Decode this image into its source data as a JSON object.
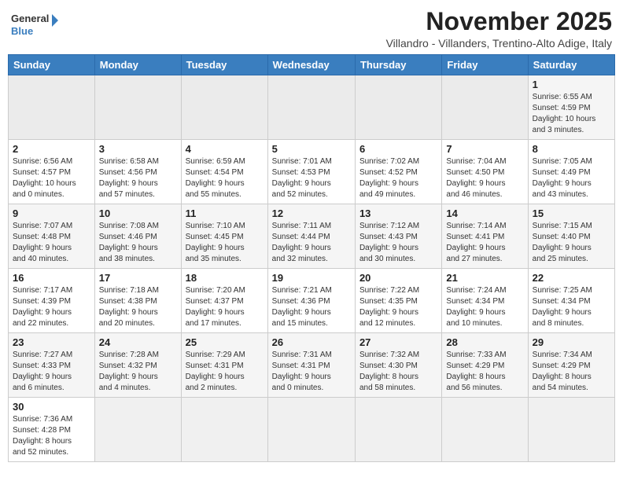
{
  "logo": {
    "text_general": "General",
    "text_blue": "Blue"
  },
  "title": "November 2025",
  "subtitle": "Villandro - Villanders, Trentino-Alto Adige, Italy",
  "weekdays": [
    "Sunday",
    "Monday",
    "Tuesday",
    "Wednesday",
    "Thursday",
    "Friday",
    "Saturday"
  ],
  "weeks": [
    [
      {
        "day": "",
        "info": ""
      },
      {
        "day": "",
        "info": ""
      },
      {
        "day": "",
        "info": ""
      },
      {
        "day": "",
        "info": ""
      },
      {
        "day": "",
        "info": ""
      },
      {
        "day": "",
        "info": ""
      },
      {
        "day": "1",
        "info": "Sunrise: 6:55 AM\nSunset: 4:59 PM\nDaylight: 10 hours\nand 3 minutes."
      }
    ],
    [
      {
        "day": "2",
        "info": "Sunrise: 6:56 AM\nSunset: 4:57 PM\nDaylight: 10 hours\nand 0 minutes."
      },
      {
        "day": "3",
        "info": "Sunrise: 6:58 AM\nSunset: 4:56 PM\nDaylight: 9 hours\nand 57 minutes."
      },
      {
        "day": "4",
        "info": "Sunrise: 6:59 AM\nSunset: 4:54 PM\nDaylight: 9 hours\nand 55 minutes."
      },
      {
        "day": "5",
        "info": "Sunrise: 7:01 AM\nSunset: 4:53 PM\nDaylight: 9 hours\nand 52 minutes."
      },
      {
        "day": "6",
        "info": "Sunrise: 7:02 AM\nSunset: 4:52 PM\nDaylight: 9 hours\nand 49 minutes."
      },
      {
        "day": "7",
        "info": "Sunrise: 7:04 AM\nSunset: 4:50 PM\nDaylight: 9 hours\nand 46 minutes."
      },
      {
        "day": "8",
        "info": "Sunrise: 7:05 AM\nSunset: 4:49 PM\nDaylight: 9 hours\nand 43 minutes."
      }
    ],
    [
      {
        "day": "9",
        "info": "Sunrise: 7:07 AM\nSunset: 4:48 PM\nDaylight: 9 hours\nand 40 minutes."
      },
      {
        "day": "10",
        "info": "Sunrise: 7:08 AM\nSunset: 4:46 PM\nDaylight: 9 hours\nand 38 minutes."
      },
      {
        "day": "11",
        "info": "Sunrise: 7:10 AM\nSunset: 4:45 PM\nDaylight: 9 hours\nand 35 minutes."
      },
      {
        "day": "12",
        "info": "Sunrise: 7:11 AM\nSunset: 4:44 PM\nDaylight: 9 hours\nand 32 minutes."
      },
      {
        "day": "13",
        "info": "Sunrise: 7:12 AM\nSunset: 4:43 PM\nDaylight: 9 hours\nand 30 minutes."
      },
      {
        "day": "14",
        "info": "Sunrise: 7:14 AM\nSunset: 4:41 PM\nDaylight: 9 hours\nand 27 minutes."
      },
      {
        "day": "15",
        "info": "Sunrise: 7:15 AM\nSunset: 4:40 PM\nDaylight: 9 hours\nand 25 minutes."
      }
    ],
    [
      {
        "day": "16",
        "info": "Sunrise: 7:17 AM\nSunset: 4:39 PM\nDaylight: 9 hours\nand 22 minutes."
      },
      {
        "day": "17",
        "info": "Sunrise: 7:18 AM\nSunset: 4:38 PM\nDaylight: 9 hours\nand 20 minutes."
      },
      {
        "day": "18",
        "info": "Sunrise: 7:20 AM\nSunset: 4:37 PM\nDaylight: 9 hours\nand 17 minutes."
      },
      {
        "day": "19",
        "info": "Sunrise: 7:21 AM\nSunset: 4:36 PM\nDaylight: 9 hours\nand 15 minutes."
      },
      {
        "day": "20",
        "info": "Sunrise: 7:22 AM\nSunset: 4:35 PM\nDaylight: 9 hours\nand 12 minutes."
      },
      {
        "day": "21",
        "info": "Sunrise: 7:24 AM\nSunset: 4:34 PM\nDaylight: 9 hours\nand 10 minutes."
      },
      {
        "day": "22",
        "info": "Sunrise: 7:25 AM\nSunset: 4:34 PM\nDaylight: 9 hours\nand 8 minutes."
      }
    ],
    [
      {
        "day": "23",
        "info": "Sunrise: 7:27 AM\nSunset: 4:33 PM\nDaylight: 9 hours\nand 6 minutes."
      },
      {
        "day": "24",
        "info": "Sunrise: 7:28 AM\nSunset: 4:32 PM\nDaylight: 9 hours\nand 4 minutes."
      },
      {
        "day": "25",
        "info": "Sunrise: 7:29 AM\nSunset: 4:31 PM\nDaylight: 9 hours\nand 2 minutes."
      },
      {
        "day": "26",
        "info": "Sunrise: 7:31 AM\nSunset: 4:31 PM\nDaylight: 9 hours\nand 0 minutes."
      },
      {
        "day": "27",
        "info": "Sunrise: 7:32 AM\nSunset: 4:30 PM\nDaylight: 8 hours\nand 58 minutes."
      },
      {
        "day": "28",
        "info": "Sunrise: 7:33 AM\nSunset: 4:29 PM\nDaylight: 8 hours\nand 56 minutes."
      },
      {
        "day": "29",
        "info": "Sunrise: 7:34 AM\nSunset: 4:29 PM\nDaylight: 8 hours\nand 54 minutes."
      }
    ],
    [
      {
        "day": "30",
        "info": "Sunrise: 7:36 AM\nSunset: 4:28 PM\nDaylight: 8 hours\nand 52 minutes."
      },
      {
        "day": "",
        "info": ""
      },
      {
        "day": "",
        "info": ""
      },
      {
        "day": "",
        "info": ""
      },
      {
        "day": "",
        "info": ""
      },
      {
        "day": "",
        "info": ""
      },
      {
        "day": "",
        "info": ""
      }
    ]
  ]
}
